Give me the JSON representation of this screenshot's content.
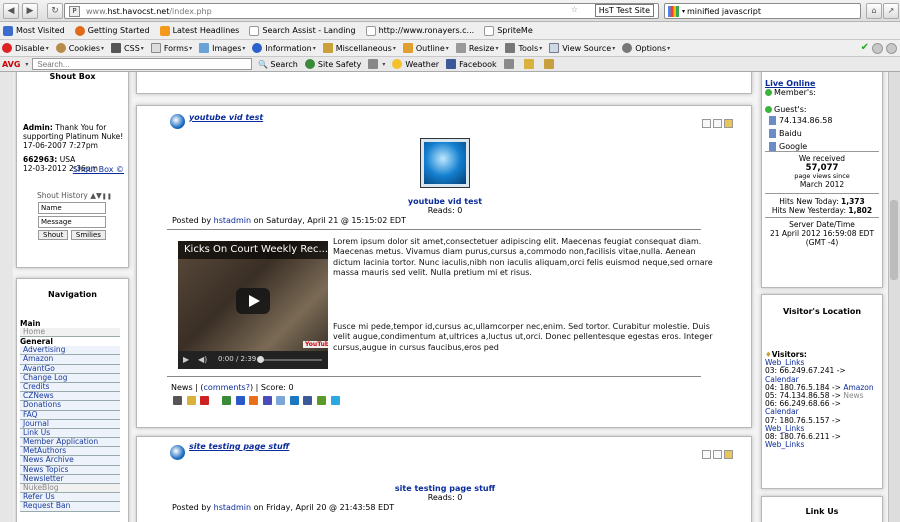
{
  "browser": {
    "url_prefix": "www.",
    "url_domain": "hst.havocst.net",
    "url_path": "/index.php",
    "tab_title": "HsT Test Site",
    "search_text": "minified javascript"
  },
  "bookmarks": [
    "Most Visited",
    "Getting Started",
    "Latest Headlines",
    "Search Assist - Landing",
    "http://www.ronayers.c...",
    "SpriteMe"
  ],
  "webdev": [
    "Disable",
    "Cookies",
    "CSS",
    "Forms",
    "Images",
    "Information",
    "Miscellaneous",
    "Outline",
    "Resize",
    "Tools",
    "View Source",
    "Options"
  ],
  "avg": {
    "logo": "AVG",
    "search_placeholder": "Search...",
    "search_btn": "Search",
    "site_safety": "Site Safety",
    "weather": "Weather",
    "facebook": "Facebook"
  },
  "shoutbox": {
    "title": "Shout Box",
    "entries": [
      {
        "name": "Admin:",
        "text": "Thank You for supporting Platinum Nuke!",
        "date": "17-06-2007 7:27pm"
      },
      {
        "name": "662963:",
        "text": "USA",
        "date": "12-03-2012 2:36pm"
      }
    ],
    "link": "Shout Box ©",
    "history": "Shout History",
    "name_ph": "Name",
    "msg_ph": "Message",
    "shout_btn": "Shout",
    "smilies_btn": "Smilies"
  },
  "navigation": {
    "title": "Navigation",
    "main_label": "Main",
    "home": "Home",
    "general_label": "General",
    "items": [
      "Advertising",
      "Amazon",
      "AvantGo",
      "Change Log",
      "Credits",
      "CZNews",
      "Donations",
      "FAQ",
      "Journal",
      "Link Us",
      "Member Application",
      "MetAuthors",
      "News Archive",
      "News Topics",
      "Newsletter",
      "NukeBlog",
      "Refer Us",
      "Request Ban"
    ]
  },
  "article1": {
    "title": "youtube vid test",
    "center_title": "youtube vid test",
    "reads": "Reads: 0",
    "posted_by": "Posted by",
    "author": "hstadmin",
    "date": "on Saturday, April 21 @ 15:15:02 EDT",
    "video_title": "Kicks On Court Weekly Rec...",
    "video_time": "0:00 / 2:39",
    "p1": "Lorem ipsum dolor sit amet,consectetuer adipiscing elit. Maecenas feugiat consequat diam. Maecenas metus. Vivamus diam purus,cursus a,commodo non,facilisis vitae,nulla. Aenean dictum lacinia tortor. Nunc iaculis,nibh non iaculis aliquam,orci felis euismod neque,sed ornare massa mauris sed velit. Nulla pretium mi et risus.",
    "p2": "Fusce mi pede,tempor id,cursus ac,ullamcorper nec,enim. Sed tortor. Curabitur molestie. Duis velit augue,condimentum at,ultrices a,luctus ut,orci. Donec pellentesque egestas eros. Integer cursus,augue in cursus faucibus,eros ped",
    "footer_news": "News",
    "footer_comments": "comments?",
    "footer_score": "Score: 0"
  },
  "article2": {
    "title": "site testing page stuff",
    "center_title": "site testing page stuff",
    "reads": "Reads: 0",
    "posted_by": "Posted by",
    "author": "hstadmin",
    "date": "on Friday, April 20 @ 21:43:58 EDT"
  },
  "online": {
    "title": "Live Online",
    "members": "Member's:",
    "guests": "Guest's:",
    "guest_list": [
      "74.134.86.58",
      "Baidu",
      "Google"
    ],
    "received": "We received",
    "views": "57,077",
    "views_label": "page views since",
    "since": "March 2012",
    "hits_today_label": "Hits New Today:",
    "hits_today": "1,373",
    "hits_yest_label": "Hits New Yesterday:",
    "hits_yest": "1,802",
    "server_label": "Server Date/Time",
    "server_time": "21 April 2012 16:59:08 EDT",
    "gmt": "(GMT -4)"
  },
  "visitors": {
    "title": "Visitor's Location",
    "label": "Visitors:",
    "list": [
      {
        "page": "Web_Links",
        "line": "03: 66.249.67.241 ->"
      },
      {
        "page": "Calendar",
        "line": "04: 180.76.5.184 ->",
        "extra": "Amazon"
      },
      {
        "page": "",
        "line": "05: 74.134.86.58 ->",
        "extra": "News"
      },
      {
        "page": "",
        "line": "06: 66.249.68.66 ->"
      },
      {
        "page": "Calendar",
        "line": "07: 180.76.5.157 ->"
      },
      {
        "page": "Web_Links",
        "line": "08: 180.76.6.211 ->"
      },
      {
        "page": "Web_Links",
        "line": ""
      }
    ],
    "link_us": "Link Us"
  }
}
